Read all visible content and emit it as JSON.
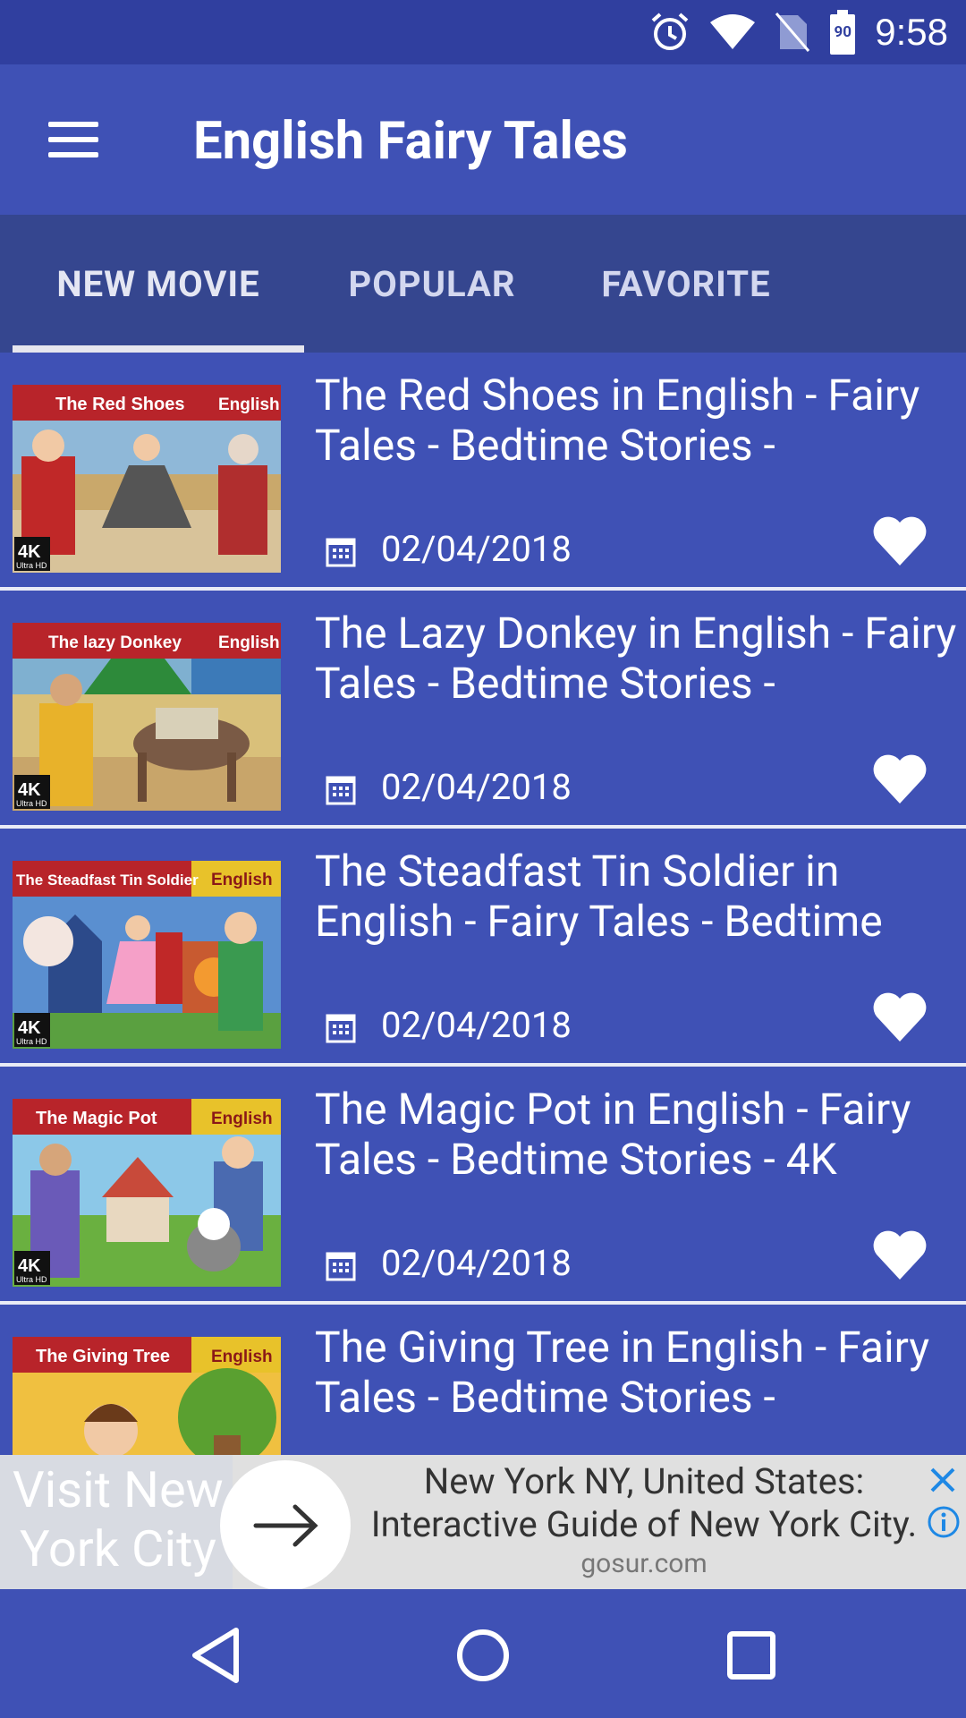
{
  "status_bar": {
    "time": "9:58",
    "battery_level": "90",
    "icons": [
      "alarm-clock-icon",
      "wifi-icon",
      "no-sim-icon",
      "battery-icon"
    ]
  },
  "app_bar": {
    "title": "English Fairy Tales",
    "menu_icon": "hamburger-menu-icon"
  },
  "tabs": [
    {
      "label": "NEW MOVIE",
      "selected": true
    },
    {
      "label": "POPULAR",
      "selected": false
    },
    {
      "label": "FAVORITE",
      "selected": false
    }
  ],
  "videos": [
    {
      "title": "The Red Shoes in English - Fairy Tales - Bedtime Stories -",
      "date": "02/04/2018",
      "thumb_title": "The Red Shoes",
      "thumb_lang": "English",
      "thumb_badge": "4K",
      "thumb_badge_sub": "Ultra HD"
    },
    {
      "title": "The Lazy Donkey in English - Fairy Tales - Bedtime Stories -",
      "date": "02/04/2018",
      "thumb_title": "The lazy Donkey",
      "thumb_lang": "English",
      "thumb_badge": "4K",
      "thumb_badge_sub": "Ultra HD"
    },
    {
      "title": "The Steadfast Tin Soldier in English - Fairy Tales - Bedtime",
      "date": "02/04/2018",
      "thumb_title": "The Steadfast Tin Soldier",
      "thumb_lang": "English",
      "thumb_badge": "4K",
      "thumb_badge_sub": "Ultra HD"
    },
    {
      "title": "The Magic Pot in English - Fairy Tales - Bedtime Stories - 4K",
      "date": "02/04/2018",
      "thumb_title": "The Magic Pot",
      "thumb_lang": "English",
      "thumb_badge": "4K",
      "thumb_badge_sub": "Ultra HD"
    },
    {
      "title": "The Giving Tree in English - Fairy Tales - Bedtime Stories -",
      "date": "",
      "thumb_title": "The Giving Tree",
      "thumb_lang": "English",
      "thumb_badge": "",
      "thumb_badge_sub": ""
    }
  ],
  "ad": {
    "left_text_line1": "Visit New",
    "left_text_line2": "York City",
    "headline_line1": "New York NY, United States:",
    "headline_line2": "Interactive Guide of New York City.",
    "url": "gosur.com"
  },
  "nav_bar": {
    "buttons": [
      "back-icon",
      "home-icon",
      "recents-icon"
    ]
  },
  "colors": {
    "primary": "#3f51b5",
    "primary_dark": "#303f9f",
    "tab_bar": "#35468f"
  }
}
